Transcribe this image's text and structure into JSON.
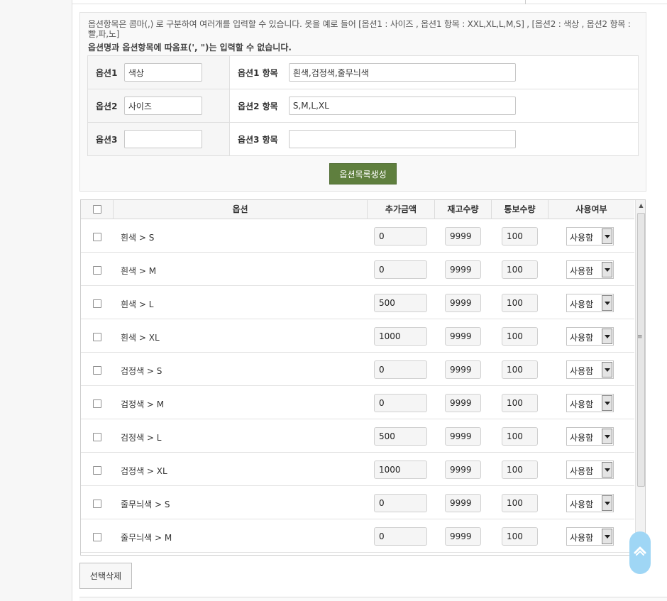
{
  "notice": {
    "line": "옵션항목은 콤마(,) 로 구분하여 여러개를 입력할 수 있습니다. 옷을 예로 들어 [옵션1 : 사이즈 , 옵션1 항목 : XXL,XL,L,M,S] , [옵션2 : 색상 , 옵션2 항목 : 빨,파,노]",
    "warning": "옵션명과 옵션항목에 따옴표(', \")는 입력할 수 없습니다."
  },
  "options": [
    {
      "label": "옵션1",
      "name": "색상",
      "items_label": "옵션1 항목",
      "items": "흰색,검정색,줄무늬색"
    },
    {
      "label": "옵션2",
      "name": "사이즈",
      "items_label": "옵션2 항목",
      "items": "S,M,L,XL"
    },
    {
      "label": "옵션3",
      "name": "",
      "items_label": "옵션3 항목",
      "items": ""
    }
  ],
  "generate_button": "옵션목록생성",
  "list": {
    "headers": {
      "option": "옵션",
      "price": "추가금액",
      "stock": "재고수량",
      "notify": "통보수량",
      "use": "사용여부"
    },
    "rows": [
      {
        "name": "흰색 > S",
        "price": "0",
        "stock": "9999",
        "notify": "100",
        "use": "사용함"
      },
      {
        "name": "흰색 > M",
        "price": "0",
        "stock": "9999",
        "notify": "100",
        "use": "사용함"
      },
      {
        "name": "흰색 > L",
        "price": "500",
        "stock": "9999",
        "notify": "100",
        "use": "사용함"
      },
      {
        "name": "흰색 > XL",
        "price": "1000",
        "stock": "9999",
        "notify": "100",
        "use": "사용함"
      },
      {
        "name": "검정색 > S",
        "price": "0",
        "stock": "9999",
        "notify": "100",
        "use": "사용함"
      },
      {
        "name": "검정색 > M",
        "price": "0",
        "stock": "9999",
        "notify": "100",
        "use": "사용함"
      },
      {
        "name": "검정색 > L",
        "price": "500",
        "stock": "9999",
        "notify": "100",
        "use": "사용함"
      },
      {
        "name": "검정색 > XL",
        "price": "1000",
        "stock": "9999",
        "notify": "100",
        "use": "사용함"
      },
      {
        "name": "줄무늬색 > S",
        "price": "0",
        "stock": "9999",
        "notify": "100",
        "use": "사용함"
      },
      {
        "name": "줄무늬색 > M",
        "price": "0",
        "stock": "9999",
        "notify": "100",
        "use": "사용함"
      }
    ]
  },
  "delete_button": "선택삭제",
  "icons": {
    "scroll_top": "chevron-up-icon",
    "scroll_up": "arrow-up-icon",
    "scroll_grip": "grip-icon"
  },
  "colors": {
    "generate_button": "#5f7f3e",
    "scroll_top": "#9fd6f5"
  }
}
